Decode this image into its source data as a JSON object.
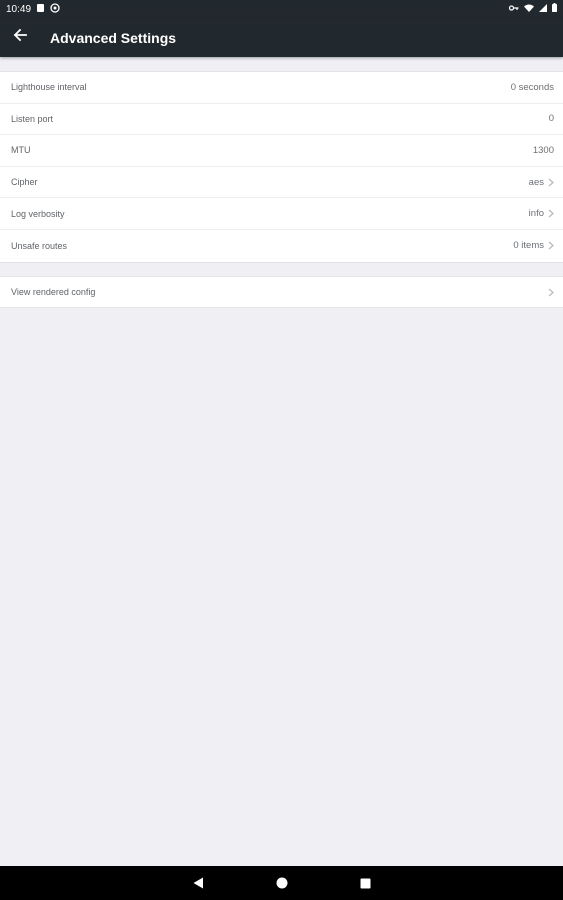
{
  "status_bar": {
    "time": "10:49"
  },
  "app_bar": {
    "title": "Advanced Settings"
  },
  "settings": [
    {
      "label": "Lighthouse interval",
      "value": "0 seconds",
      "chevron": false
    },
    {
      "label": "Listen port",
      "value": "0",
      "chevron": false
    },
    {
      "label": "MTU",
      "value": "1300",
      "chevron": false
    },
    {
      "label": "Cipher",
      "value": "aes",
      "chevron": true
    },
    {
      "label": "Log verbosity",
      "value": "info",
      "chevron": true
    },
    {
      "label": "Unsafe routes",
      "value": "0 items",
      "chevron": true
    }
  ],
  "config": {
    "label": "View rendered config"
  },
  "icons": {
    "back": "arrow-back-icon",
    "chevron": "chevron-right-icon",
    "nav_back": "triangle-back-icon",
    "nav_home": "circle-home-icon",
    "nav_recents": "square-recents-icon"
  },
  "colors": {
    "app_bar": "#22292e",
    "background": "#efeff4"
  }
}
